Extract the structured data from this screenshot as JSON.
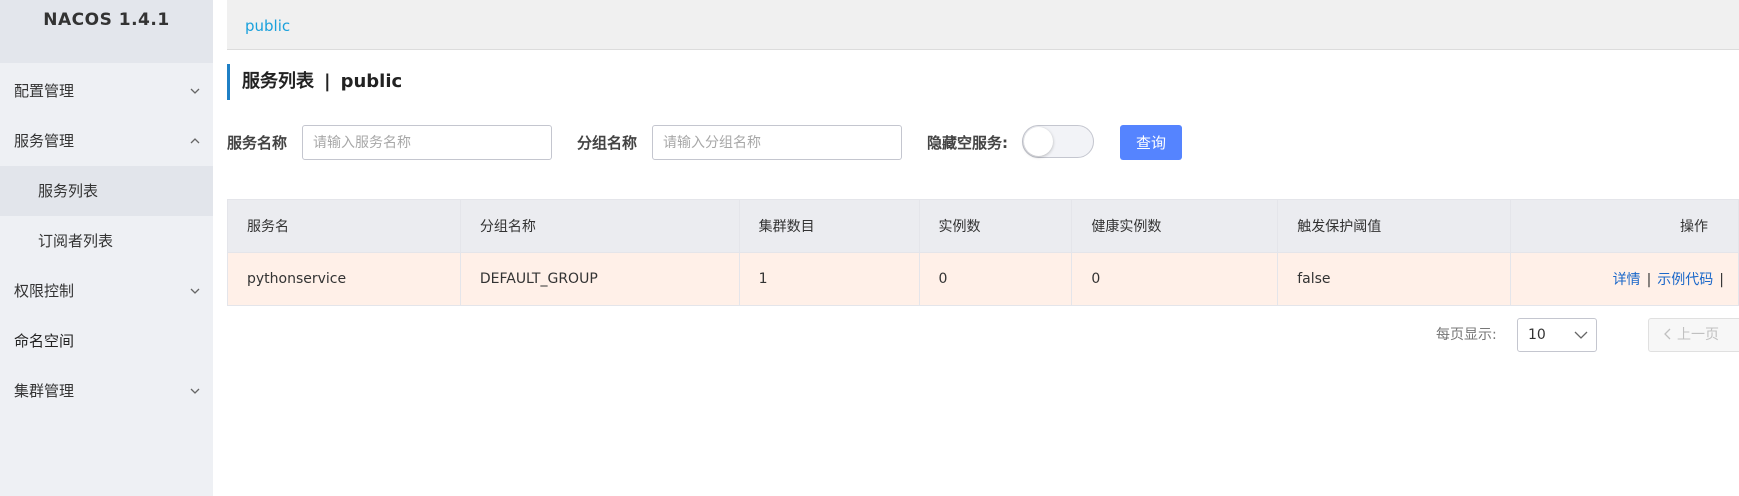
{
  "brand": "NACOS 1.4.1",
  "sidebar": {
    "items": [
      {
        "label": "配置管理"
      },
      {
        "label": "服务管理"
      },
      {
        "label": "服务列表"
      },
      {
        "label": "订阅者列表"
      },
      {
        "label": "权限控制"
      },
      {
        "label": "命名空间"
      },
      {
        "label": "集群管理"
      }
    ]
  },
  "topbar": {
    "namespace": "public"
  },
  "page": {
    "title": "服务列表",
    "separator": "|",
    "namespace": "public"
  },
  "filters": {
    "service_name_label": "服务名称",
    "service_name_placeholder": "请输入服务名称",
    "group_name_label": "分组名称",
    "group_name_placeholder": "请输入分组名称",
    "hide_empty_label": "隐藏空服务:",
    "hide_empty_on": false,
    "query_button": "查询"
  },
  "table": {
    "columns": [
      "服务名",
      "分组名称",
      "集群数目",
      "实例数",
      "健康实例数",
      "触发保护阈值",
      "操作"
    ],
    "rows": [
      {
        "service": "pythonservice",
        "group": "DEFAULT_GROUP",
        "clusters": "1",
        "instances": "0",
        "healthy": "0",
        "threshold": "false",
        "ops": {
          "detail": "详情",
          "sample": "示例代码",
          "sep": "|"
        }
      }
    ]
  },
  "pagination": {
    "per_page_label": "每页显示:",
    "per_page_value": "10",
    "prev_label": "上一页"
  },
  "colors": {
    "accent": "#5584ff",
    "link": "#1a67c9",
    "row_highlight": "#fff0e8",
    "sidebar_bg": "#eef0f4"
  }
}
